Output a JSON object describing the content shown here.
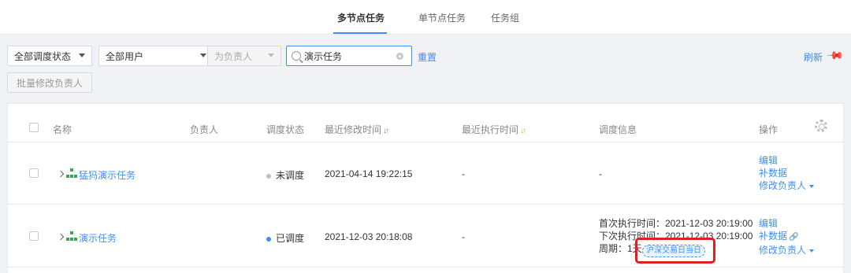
{
  "tabs": [
    {
      "label": "多节点任务",
      "active": true
    },
    {
      "label": "单节点任务",
      "active": false
    },
    {
      "label": "任务组",
      "active": false
    }
  ],
  "filters": {
    "schedule_status": "全部调度状态",
    "user": "全部用户",
    "owner_role": "为负责人",
    "search_value": "演示任务",
    "reset_label": "重置",
    "refresh_label": "刷新",
    "batch_label": "批量修改负责人"
  },
  "table": {
    "headers": {
      "name": "名称",
      "owner": "负责人",
      "status": "调度状态",
      "modified": "最近修改时间",
      "executed": "最近执行时间",
      "schedule_info": "调度信息",
      "ops": "操作"
    },
    "rows": [
      {
        "name": "猛犸演示任务",
        "owner": "",
        "status": "未调度",
        "status_color": "#bfbfbf",
        "modified": "2021-04-14 19:22:15",
        "executed": "-",
        "schedule_info": "-",
        "ops": {
          "edit": "编辑",
          "backfill": "补数据",
          "change_owner": "修改负责人"
        }
      },
      {
        "name": "演示任务",
        "owner": "",
        "status": "已调度",
        "status_color": "#3f8ef6",
        "modified": "2021-12-03 20:18:08",
        "executed": "-",
        "schedule_info": {
          "first_run": "首次执行时间：2021-12-03 20:19:00",
          "next_run": "下次执行时间：2021-12-03 20:19:00",
          "period": "周期：1天",
          "tag": "沪深交易日当日"
        },
        "ops": {
          "edit": "编辑",
          "backfill": "补数据",
          "change_owner": "修改负责人"
        }
      }
    ]
  },
  "colors": {
    "accent": "#3f8ef6",
    "highlight": "#e02020",
    "flow_icon": "#35a85b"
  },
  "icons": [
    "search-icon",
    "clear-icon",
    "pin-icon",
    "gear-icon",
    "flow-icon",
    "link-icon"
  ]
}
